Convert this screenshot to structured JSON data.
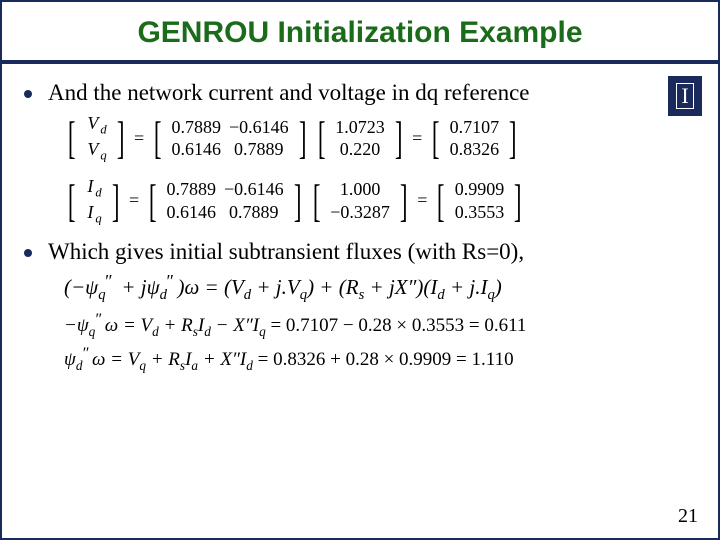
{
  "title": "GENROU Initialization Example",
  "logo_letter": "I",
  "bullets": {
    "b1": "And the network current and voltage in dq reference",
    "b2": "Which gives initial subtransient fluxes (with Rs=0),"
  },
  "eq_v": {
    "lhs": {
      "r1": "V",
      "r1s": "d",
      "r2": "V",
      "r2s": "q"
    },
    "mat": {
      "a11": "0.7889",
      "a12": "−0.6146",
      "a21": "0.6146",
      "a22": "0.7889"
    },
    "vec": {
      "r1": "1.0723",
      "r2": "0.220"
    },
    "res": {
      "r1": "0.7107",
      "r2": "0.8326"
    }
  },
  "eq_i": {
    "lhs": {
      "r1": "I",
      "r1s": "d",
      "r2": "I",
      "r2s": "q"
    },
    "mat": {
      "a11": "0.7889",
      "a12": "−0.6146",
      "a21": "0.6146",
      "a22": "0.7889"
    },
    "vec": {
      "r1": "1.000",
      "r2": "−0.3287"
    },
    "res": {
      "r1": "0.9909",
      "r2": "0.3553"
    }
  },
  "flux": {
    "line1_a": "(−ψ",
    "line1_b": " + jψ",
    "line1_c": ")ω = (V",
    "line1_d": " + j.V",
    "line1_e": ") + (R",
    "line1_f": " + jX″)(I",
    "line1_g": " + j.I",
    "line1_h": ")",
    "line2_a": "−ψ",
    "line2_b": "ω = V",
    "line2_c": " + R",
    "line2_d": "I",
    "line2_e": " − X″I",
    "line2_eq": " = 0.7107 − 0.28 × 0.3553 = 0.611",
    "line3_a": "ψ",
    "line3_b": "ω = V",
    "line3_c": " + R",
    "line3_d": "I",
    "line3_e": " + X″I",
    "line3_eq": " = 0.8326 + 0.28 × 0.9909 = 1.110"
  },
  "page_number": "21"
}
